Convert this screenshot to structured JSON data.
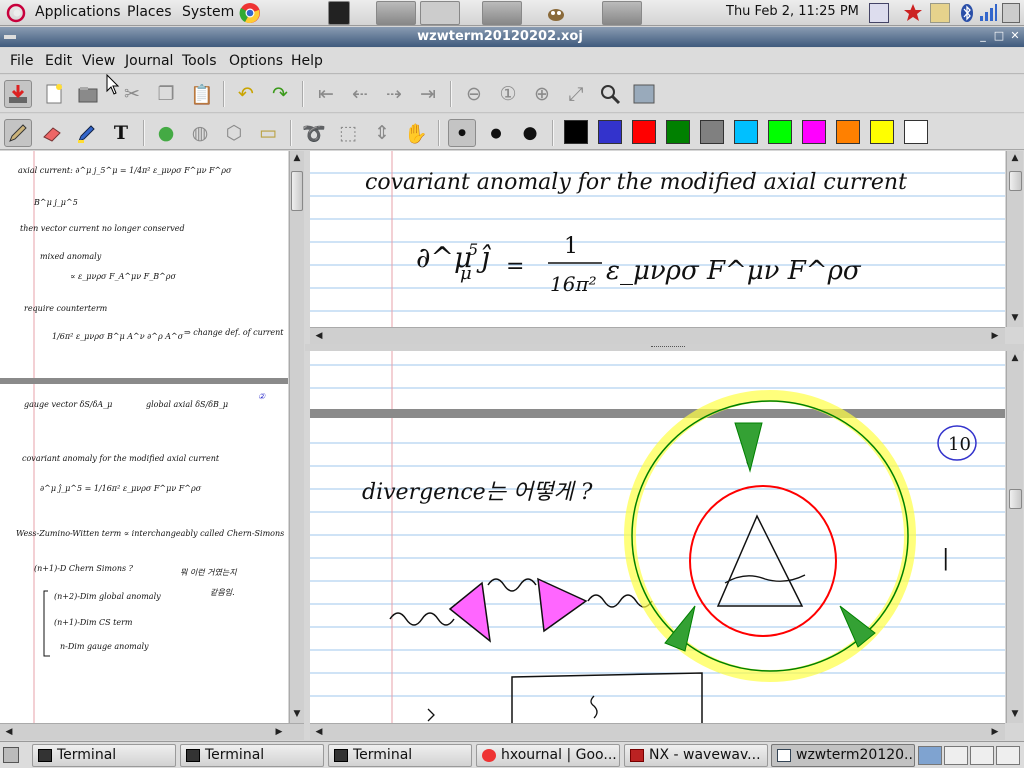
{
  "top_panel": {
    "applications": "Applications",
    "places": "Places",
    "system": "System",
    "clock": "Thu Feb  2, 11:25 PM"
  },
  "window": {
    "title": "wzwterm20120202.xoj",
    "minimize": "_",
    "maximize": "□",
    "close": "✕"
  },
  "menubar": [
    "File",
    "Edit",
    "View",
    "Journal",
    "Tools",
    "Options",
    "Help"
  ],
  "colors": {
    "palette": [
      "#000000",
      "#3333cc",
      "#ff0000",
      "#008000",
      "#808080",
      "#00c0ff",
      "#00ff00",
      "#ff00ff",
      "#ff8000",
      "#ffff00",
      "#ffffff"
    ],
    "ruling_blue": "#9fc7ee",
    "margin_red": "#e7a1a9",
    "titlebar": "#4a6388"
  },
  "toolbar1_icons": [
    "save-icon",
    "new-icon",
    "open-icon",
    "cut-icon",
    "copy-icon",
    "paste-icon",
    "undo-icon",
    "redo-icon",
    "first-page-icon",
    "prev-page-icon",
    "next-page-icon",
    "last-page-icon",
    "zoom-out-icon",
    "zoom-100-icon",
    "zoom-in-icon",
    "zoom-fit-icon",
    "find-icon",
    "fullscreen-icon"
  ],
  "toolbar2_icons": [
    "pen-icon",
    "eraser-icon",
    "highlighter-icon",
    "text-icon",
    "default-tool-icon",
    "ruler-icon",
    "shape-recognizer-icon",
    "image-icon",
    "lasso-icon",
    "rect-select-icon",
    "vertical-space-icon",
    "hand-icon",
    "thin-icon",
    "medium-icon",
    "thick-icon"
  ],
  "left_page": {
    "line1": "axial current: ∂^μ j_5^μ = 1/4π² ε_μνρσ F^μν F^ρσ",
    "line2": "B^μ j_μ^5",
    "line3": "then vector current no longer conserved",
    "line4": "mixed anomaly",
    "line5": "∝ ε_μνρσ F_A^μν F_B^ρσ",
    "line6": "require counterterm",
    "line7": "1/6π² ε_μνρσ B^μ A^ν ∂^ρ A^σ",
    "line8": "⇒ change def. of current",
    "line9": "gauge vector δS/δA_μ",
    "line10": "global axial δS/δB_μ",
    "page_num": "②",
    "line11": "covariant anomaly for the modified axial current",
    "line12": "∂^μ ĵ_μ^5 = 1/16π² ε_μνρσ F^μν F^ρσ",
    "line13": "Wess-Zumino-Witten term ∝ interchangeably called Chern-Simons",
    "line14": "(n+1)-D Chern Simons ?",
    "line15": "뭐 이런 거였는지",
    "line16": "(n+2)-Dim global anomaly",
    "line17": "같음임.",
    "line18": "(n+1)-Dim CS term",
    "line19": "n-Dim gauge anomaly"
  },
  "top_right_page": {
    "heading": "covariant anomaly for the modified axial current",
    "eq_lhs": "∂^μ ĵ",
    "eq_sup": "5",
    "eq_sub": "μ",
    "eq_eq": "=",
    "eq_num": "1",
    "eq_den": "16π²",
    "eq_rhs": "ε_μνρσ F^μν F^ρσ"
  },
  "bottom_right_page": {
    "divergence": "divergence는 어떻게 ?",
    "page_num": "10",
    "mark": "|"
  },
  "taskbar": {
    "tasks": [
      "Terminal",
      "Terminal",
      "Terminal",
      "hxournal | Goo...",
      "NX - wavewav...",
      "wzwterm20120..."
    ]
  }
}
